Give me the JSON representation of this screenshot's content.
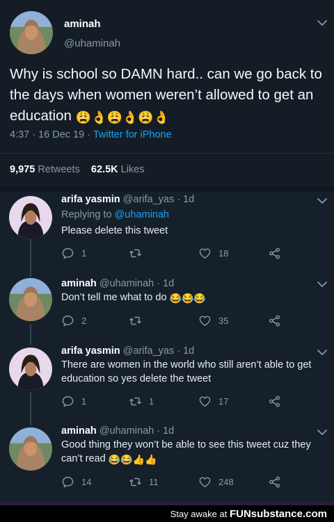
{
  "main_tweet": {
    "name": "aminah",
    "handle": "@uhaminah",
    "text": "Why is school so DAMN hard.. can we go back to the days when women weren’t allowed to get an education",
    "emojis": "😩👌😩👌😩👌",
    "time": "4:37 · 16 Dec 19 · ",
    "source": "Twitter for iPhone",
    "retweets_count": "9,975",
    "retweets_label": "Retweets",
    "likes_count": "62.5K",
    "likes_label": "Likes"
  },
  "replies": [
    {
      "name": "arifa yasmin",
      "handle_time": " @arifa_yas · 1d",
      "replying_prefix": "Replying to ",
      "replying_handle": "@uhaminah",
      "text": "Please delete this tweet",
      "emojis": "",
      "reply_count": "1",
      "retweet_count": "",
      "like_count": "18"
    },
    {
      "name": "aminah",
      "handle_time": " @uhaminah · 1d",
      "text": "Don’t tell me what to do",
      "emojis": "😂😂😂",
      "reply_count": "2",
      "retweet_count": "",
      "like_count": "35"
    },
    {
      "name": "arifa yasmin",
      "handle_time": " @arifa_yas · 1d",
      "text": "There are women in the world who still aren’t able to get education so yes delete the tweet",
      "emojis": "",
      "reply_count": "1",
      "retweet_count": "1",
      "like_count": "17"
    },
    {
      "name": "aminah",
      "handle_time": " @uhaminah · 1d",
      "text": "Good thing they won’t be able to see this tweet cuz they can’t read",
      "emojis": "😂😂👍👍",
      "reply_count": "14",
      "retweet_count": "11",
      "like_count": "248"
    }
  ],
  "footer": {
    "prefix": "Stay awake at ",
    "brand": "FUNsubstance.com"
  },
  "icons": [
    "reply-icon",
    "retweet-icon",
    "like-icon",
    "share-icon",
    "chevron-down-icon"
  ],
  "colors": {
    "background": "#15202b",
    "link": "#1da1f2",
    "muted": "#8899a6"
  }
}
